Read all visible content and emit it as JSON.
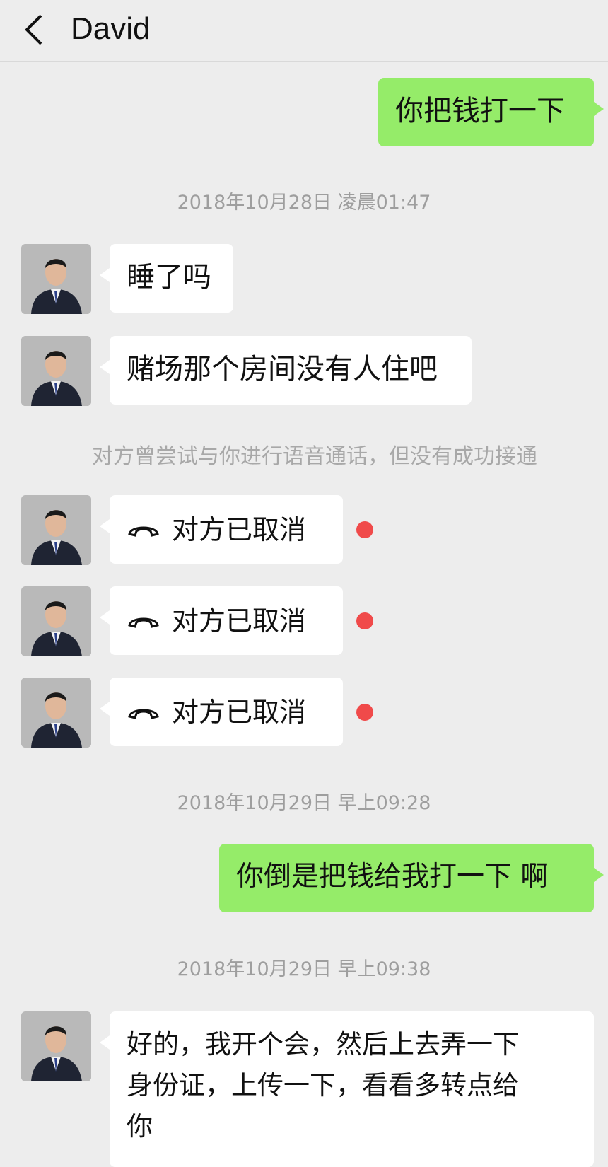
{
  "header": {
    "title": "David",
    "back_icon": "chevron-left-icon"
  },
  "messages": {
    "m1": "你把钱打一下",
    "t1": "2018年10月28日 凌晨01:47",
    "m2": "睡了吗",
    "m3": "赌场那个房间没有人住吧",
    "sys1": "对方曾尝试与你进行语音通话，但没有成功接通",
    "call1": "对方已取消",
    "call2": "对方已取消",
    "call3": "对方已取消",
    "t2": "2018年10月29日 早上09:28",
    "m4": "你倒是把钱给我打一下 啊",
    "t3": "2018年10月29日 早上09:38",
    "m5_line1": "好的，我开个会，然后上去弄一下",
    "m5_line2": "身份证，上传一下，看看多转点给",
    "m5_line3": "你"
  },
  "colors": {
    "background": "#ededed",
    "my_bubble": "#95ec69",
    "their_bubble": "#ffffff",
    "unread_dot": "#f04a4a"
  },
  "icons": {
    "call": "phone-hangup-icon",
    "unread": "red-dot-icon"
  }
}
